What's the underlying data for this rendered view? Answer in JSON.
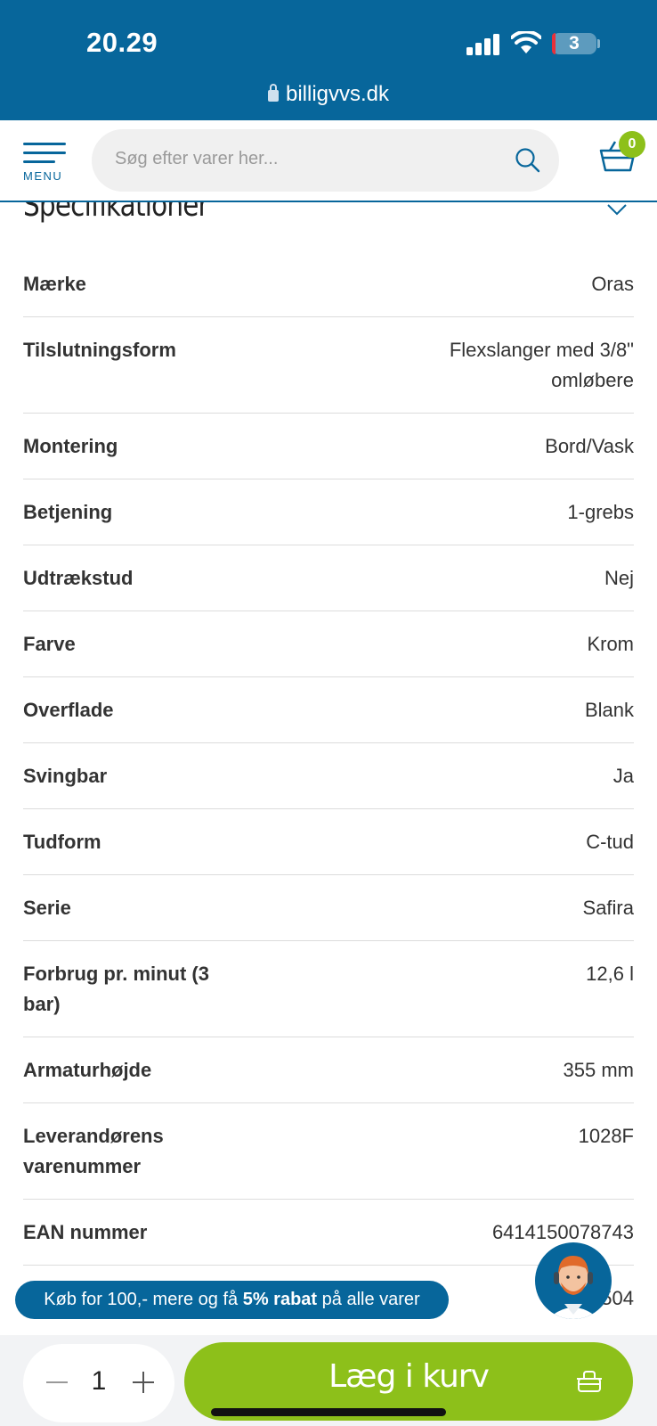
{
  "status_bar": {
    "time": "20.29",
    "battery": "3",
    "url": "billigvvs.dk"
  },
  "header": {
    "menu_label": "MENU",
    "search_placeholder": "Søg efter varer her...",
    "cart_count": "0"
  },
  "specs": {
    "title": "Specifikationer",
    "rows": [
      {
        "key": "Mærke",
        "value": "Oras"
      },
      {
        "key": "Tilslutningsform",
        "value": "Flexslanger med 3/8\" omløbere"
      },
      {
        "key": "Montering",
        "value": "Bord/Vask"
      },
      {
        "key": "Betjening",
        "value": "1-grebs"
      },
      {
        "key": "Udtrækstud",
        "value": "Nej"
      },
      {
        "key": "Farve",
        "value": "Krom"
      },
      {
        "key": "Overflade",
        "value": "Blank"
      },
      {
        "key": "Svingbar",
        "value": "Ja"
      },
      {
        "key": "Tudform",
        "value": "C-tud"
      },
      {
        "key": "Serie",
        "value": "Safira"
      },
      {
        "key": "Forbrug pr. minut (3 bar)",
        "value": "12,6 l"
      },
      {
        "key": "Armaturhøjde",
        "value": "355 mm"
      },
      {
        "key": "Leverandørens varenummer",
        "value": "1028F"
      },
      {
        "key": "EAN nummer",
        "value": "6414150078743"
      },
      {
        "key": "",
        "value": "7...504"
      }
    ]
  },
  "promo": {
    "prefix": "Køb for 100,- mere og få ",
    "bold": "5% rabat",
    "suffix": " på alle varer"
  },
  "bottom": {
    "quantity": "1",
    "add_to_cart": "Læg i kurv"
  },
  "colors": {
    "brand_blue": "#07669b",
    "accent_green": "#8dc01a"
  },
  "icons": [
    "signal-icon",
    "wifi-icon",
    "battery-icon",
    "lock-icon",
    "menu-icon",
    "search-icon",
    "cart-icon",
    "chevron-down-icon",
    "support-avatar",
    "minus-icon",
    "plus-icon",
    "basket-icon"
  ]
}
